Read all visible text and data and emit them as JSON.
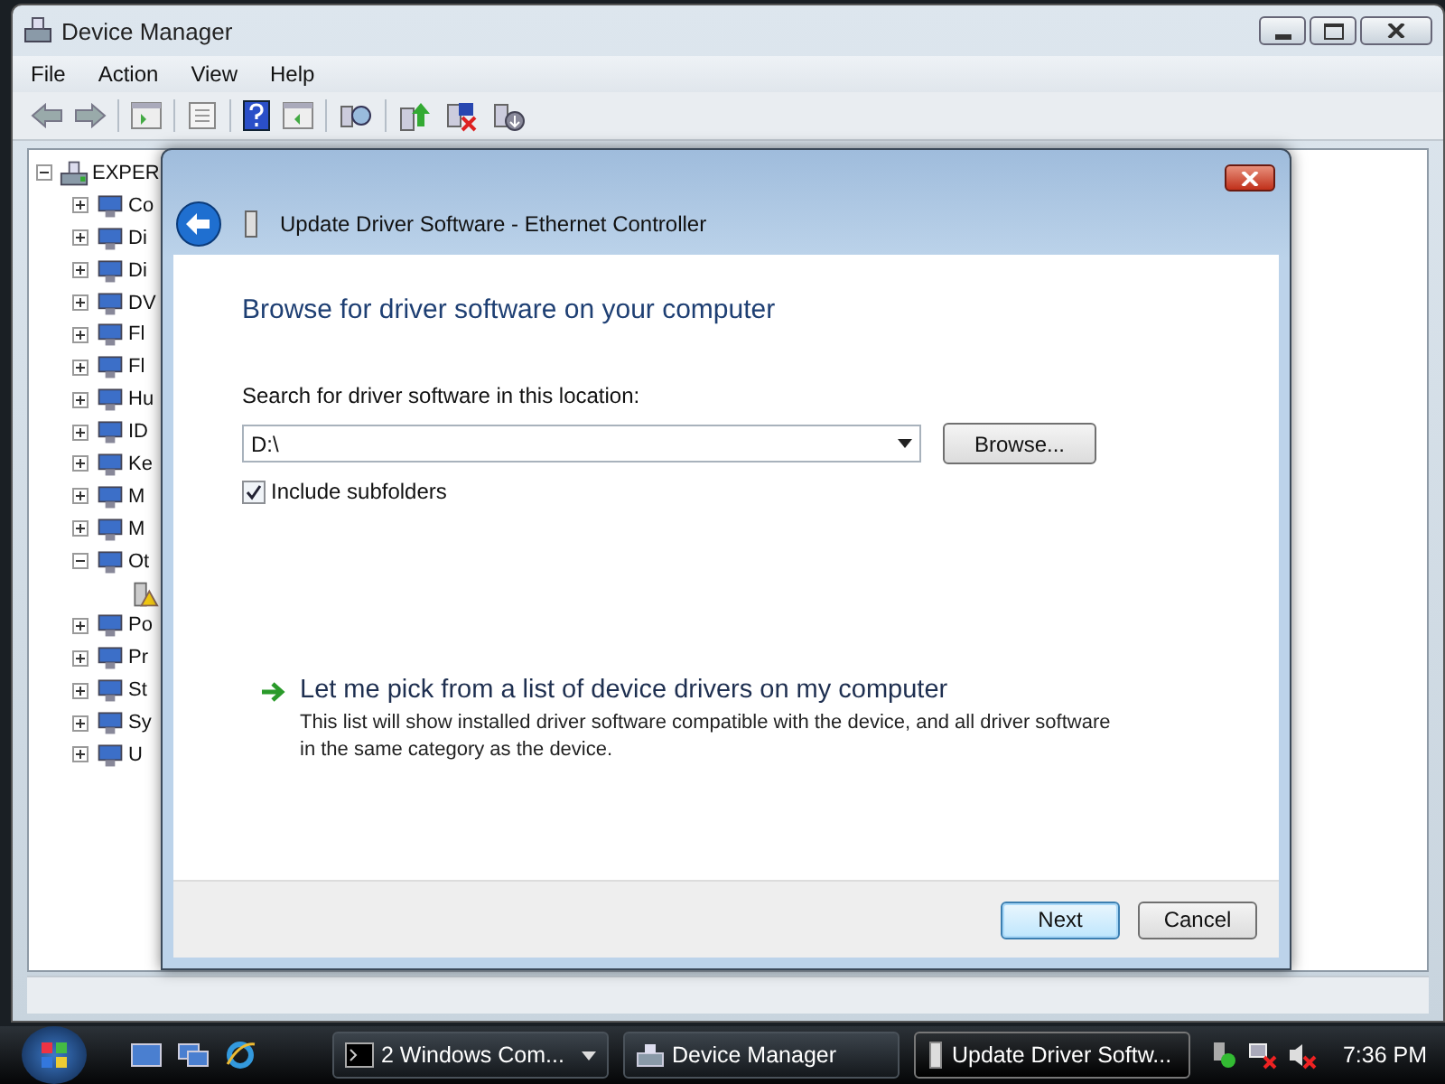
{
  "window": {
    "title": "Device Manager"
  },
  "menu": [
    "File",
    "Action",
    "View",
    "Help"
  ],
  "tree": {
    "label": "EXPER",
    "expanded": true,
    "children": [
      {
        "label": "Co",
        "expanded": false
      },
      {
        "label": "Di",
        "expanded": false
      },
      {
        "label": "Di",
        "expanded": false
      },
      {
        "label": "DV",
        "expanded": false
      },
      {
        "label": "Fl",
        "expanded": false
      },
      {
        "label": "Fl",
        "expanded": false
      },
      {
        "label": "Hu",
        "expanded": false
      },
      {
        "label": "ID",
        "expanded": false
      },
      {
        "label": "Ke",
        "expanded": false
      },
      {
        "label": "M",
        "expanded": false
      },
      {
        "label": "M",
        "expanded": false
      },
      {
        "label": "Ot",
        "expanded": true,
        "children": [
          {
            "warning": true
          }
        ]
      },
      {
        "label": "Po",
        "expanded": false
      },
      {
        "label": "Pr",
        "expanded": false
      },
      {
        "label": "St",
        "expanded": false
      },
      {
        "label": "Sy",
        "expanded": false
      },
      {
        "label": "U",
        "expanded": false
      }
    ]
  },
  "dialog": {
    "title": "Update Driver Software - Ethernet Controller",
    "heading": "Browse for driver software on your computer",
    "search_label": "Search for driver software in this location:",
    "path": {
      "value": "D:\\"
    },
    "browse_button": "Browse...",
    "include_subfolders": {
      "label": "Include subfolders",
      "checked": true
    },
    "pick_link": {
      "title": "Let me pick from a list of device drivers on my computer",
      "description": "This list will show installed driver software compatible with the device, and all driver software in the same category as the device."
    },
    "buttons": [
      {
        "label": "Next",
        "default": true
      },
      {
        "label": "Cancel",
        "default": false
      }
    ]
  },
  "taskbar": {
    "tasks": [
      {
        "label": "2 Windows Com...",
        "selected": false
      },
      {
        "label": "Device Manager",
        "selected": false
      },
      {
        "label": "Update Driver Softw...",
        "selected": true
      }
    ],
    "clock": "7:36 PM"
  }
}
